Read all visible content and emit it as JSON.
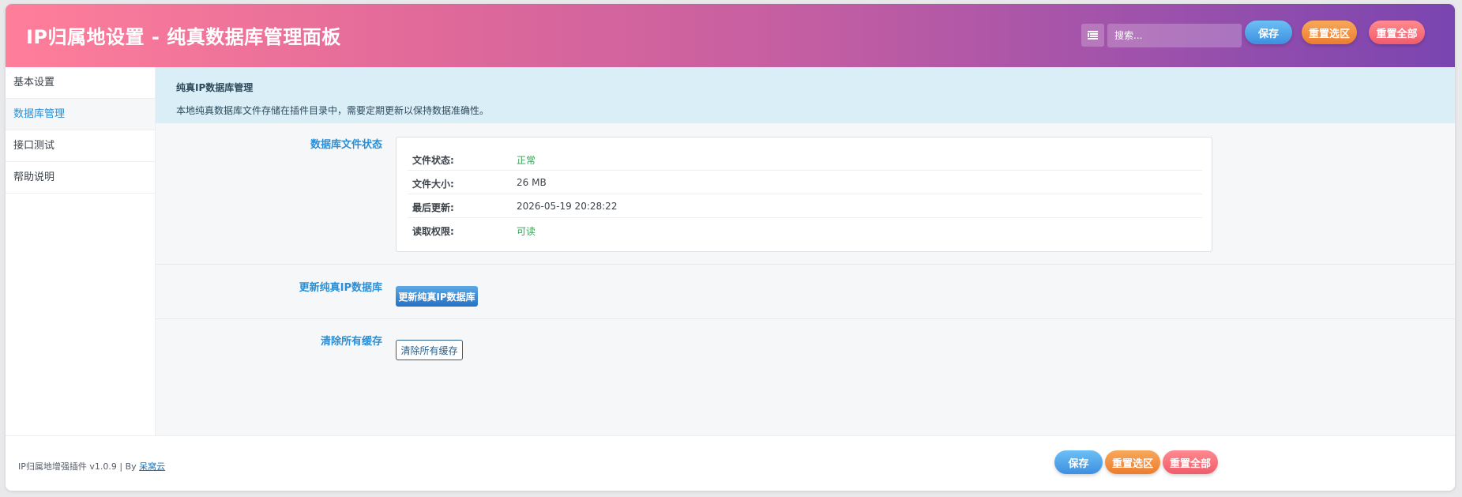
{
  "header": {
    "title": "IP归属地设置 - 纯真数据库管理面板",
    "search_placeholder": "搜索...",
    "save_label": "保存",
    "reset_section_label": "重置选区",
    "reset_all_label": "重置全部"
  },
  "sidebar": {
    "items": [
      {
        "label": "基本设置",
        "active": false
      },
      {
        "label": "数据库管理",
        "active": true
      },
      {
        "label": "接口测试",
        "active": false
      },
      {
        "label": "帮助说明",
        "active": false
      }
    ]
  },
  "notice": {
    "title": "纯真IP数据库管理",
    "description": "本地纯真数据库文件存储在插件目录中，需要定期更新以保持数据准确性。"
  },
  "db_status": {
    "label": "数据库文件状态",
    "rows": [
      {
        "key": "文件状态:",
        "value": "正常",
        "status": "ok"
      },
      {
        "key": "文件大小:",
        "value": "26 MB",
        "status": "plain"
      },
      {
        "key": "最后更新:",
        "value": "2026-05-19 20:28:22",
        "status": "plain"
      },
      {
        "key": "读取权限:",
        "value": "可读",
        "status": "ok"
      }
    ]
  },
  "update_section": {
    "label": "更新纯真IP数据库",
    "button_label": "更新纯真IP数据库"
  },
  "clear_section": {
    "label": "清除所有缓存",
    "button_label": "清除所有缓存"
  },
  "footer": {
    "text": "IP归属地增强插件 v1.0.9 | By ",
    "author": "呆窝云",
    "save_label": "保存",
    "reset_section_label": "重置选区",
    "reset_all_label": "重置全部"
  },
  "colors": {
    "header_gradient_start": "#ff7e9a",
    "header_gradient_end": "#7a45b0",
    "accent_blue": "#2a8fd6",
    "ok_green": "#3aa15a",
    "notice_bg": "#daeef8"
  }
}
